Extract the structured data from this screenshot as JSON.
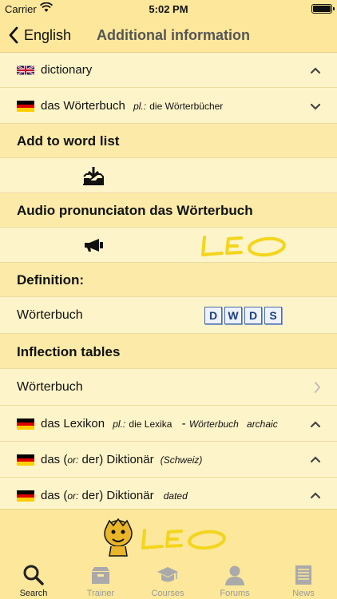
{
  "status": {
    "carrier": "Carrier",
    "time": "5:02 PM"
  },
  "nav": {
    "back_label": "English",
    "title": "Additional information"
  },
  "entries": {
    "en_word": "dictionary",
    "de_word": "das Wörterbuch",
    "de_plural_prefix": "pl.:",
    "de_plural": "die Wörterbücher"
  },
  "sections": {
    "word_list": "Add to word list",
    "audio": "Audio pronunciaton das Wörterbuch",
    "definition": "Definition:",
    "definition_word": "Wörterbuch",
    "dwds_letters": [
      "D",
      "W",
      "D",
      "S"
    ],
    "leo_text": "LEO",
    "inflection": "Inflection tables",
    "inflection_word": "Wörterbuch"
  },
  "related": [
    {
      "main": "das Lexikon",
      "pl_prefix": "pl.:",
      "pl": "die Lexika",
      "dash": "-",
      "ref": "Wörterbuch",
      "note": "archaic"
    },
    {
      "main1": "das (",
      "or": "or:",
      "main2": " der) Diktionär",
      "note": "(Schweiz)"
    },
    {
      "main1": "das (",
      "or": "or:",
      "main2": " der) Diktionär",
      "note": "dated"
    }
  ],
  "footer_logo_text": "LEO",
  "tabs": [
    {
      "label": "Search",
      "icon": "search-icon"
    },
    {
      "label": "Trainer",
      "icon": "trainer-box-icon"
    },
    {
      "label": "Courses",
      "icon": "graduation-cap-icon"
    },
    {
      "label": "Forums",
      "icon": "person-icon"
    },
    {
      "label": "News",
      "icon": "newspaper-icon"
    }
  ],
  "colors": {
    "background": "#fbe9a6",
    "row_light": "#fdf4c9",
    "leo_yellow": "#f3d51c",
    "dwds_blue": "#1d3f80"
  }
}
